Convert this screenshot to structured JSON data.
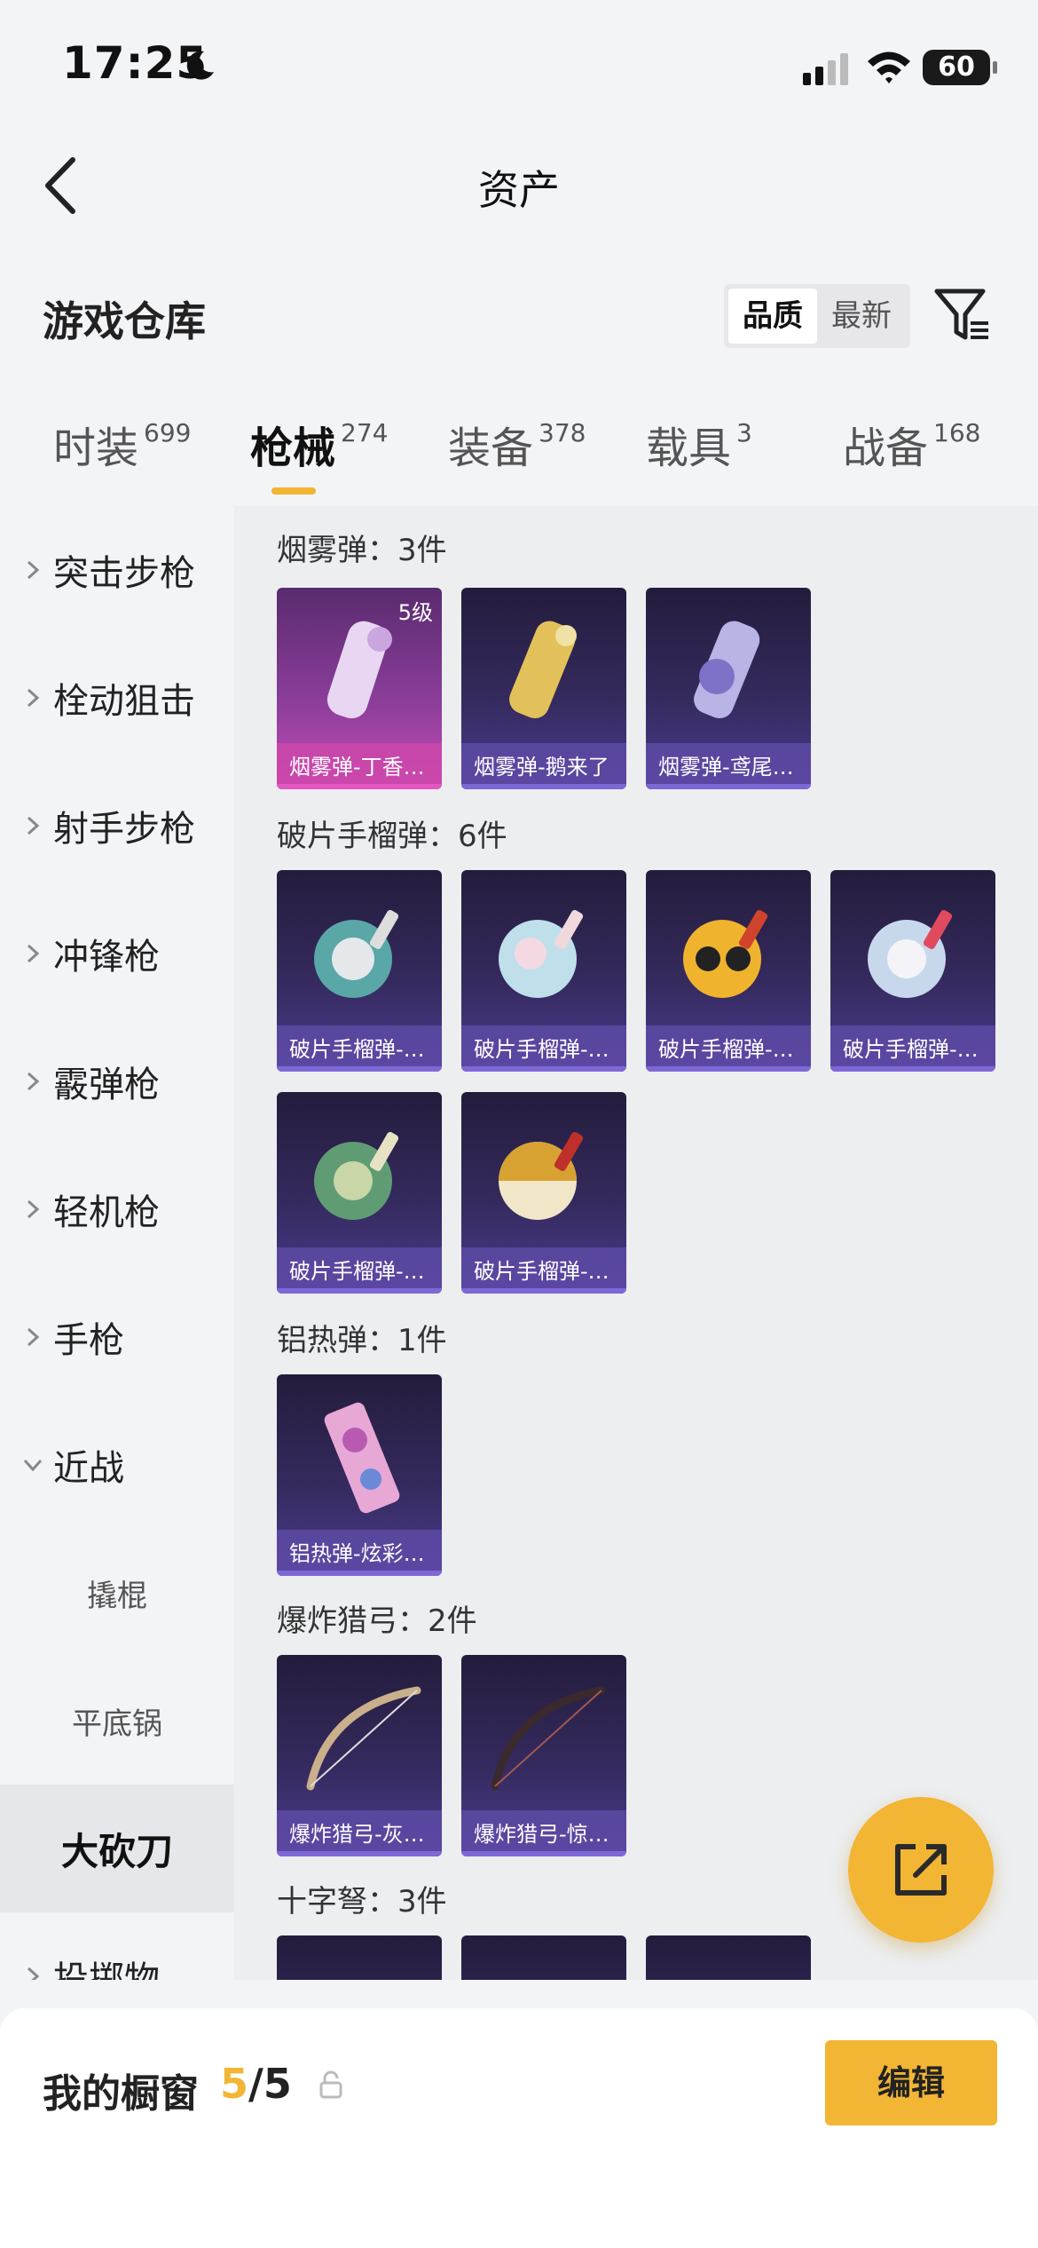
{
  "status_bar": {
    "time": "17:25",
    "battery": "60"
  },
  "nav": {
    "title": "资产"
  },
  "header": {
    "title": "游戏仓库",
    "sort_options": [
      "品质",
      "最新"
    ],
    "sort_selected": "品质"
  },
  "tabs": [
    {
      "label": "时装",
      "count": "699"
    },
    {
      "label": "枪械",
      "count": "274",
      "active": true
    },
    {
      "label": "装备",
      "count": "378"
    },
    {
      "label": "载具",
      "count": "3"
    },
    {
      "label": "战备",
      "count": "168"
    }
  ],
  "sidebar": {
    "items": [
      {
        "label": "突击步枪"
      },
      {
        "label": "栓动狙击"
      },
      {
        "label": "射手步枪"
      },
      {
        "label": "冲锋枪"
      },
      {
        "label": "霰弹枪"
      },
      {
        "label": "轻机枪"
      },
      {
        "label": "手枪"
      },
      {
        "label": "近战"
      },
      {
        "label": "撬棍"
      },
      {
        "label": "平底锅"
      },
      {
        "label": "大砍刀"
      },
      {
        "label": "投掷物"
      }
    ]
  },
  "groups": [
    {
      "label": "烟雾弹：3件",
      "items": [
        {
          "name": "烟雾弹-丁香…",
          "level": "5级",
          "rarity": "pink"
        },
        {
          "name": "烟雾弹-鹅来了"
        },
        {
          "name": "烟雾弹-鸢尾…"
        }
      ]
    },
    {
      "label": "破片手榴弹：6件",
      "items": [
        {
          "name": "破片手榴弹-…"
        },
        {
          "name": "破片手榴弹-…"
        },
        {
          "name": "破片手榴弹-…"
        },
        {
          "name": "破片手榴弹-…"
        },
        {
          "name": "破片手榴弹-…"
        },
        {
          "name": "破片手榴弹-…"
        }
      ]
    },
    {
      "label": "铝热弹：1件",
      "items": [
        {
          "name": "铝热弹-炫彩…"
        }
      ]
    },
    {
      "label": "爆炸猎弓：2件",
      "items": [
        {
          "name": "爆炸猎弓-灰…"
        },
        {
          "name": "爆炸猎弓-惊…"
        }
      ]
    },
    {
      "label": "十字弩：3件",
      "items": []
    }
  ],
  "showcase": {
    "title": "我的橱窗",
    "current": "5",
    "total": "/5",
    "edit_label": "编辑"
  },
  "colors": {
    "accent": "#f2b534",
    "card_purple": "#4b3c8e",
    "card_pink": "#c24cb6"
  }
}
